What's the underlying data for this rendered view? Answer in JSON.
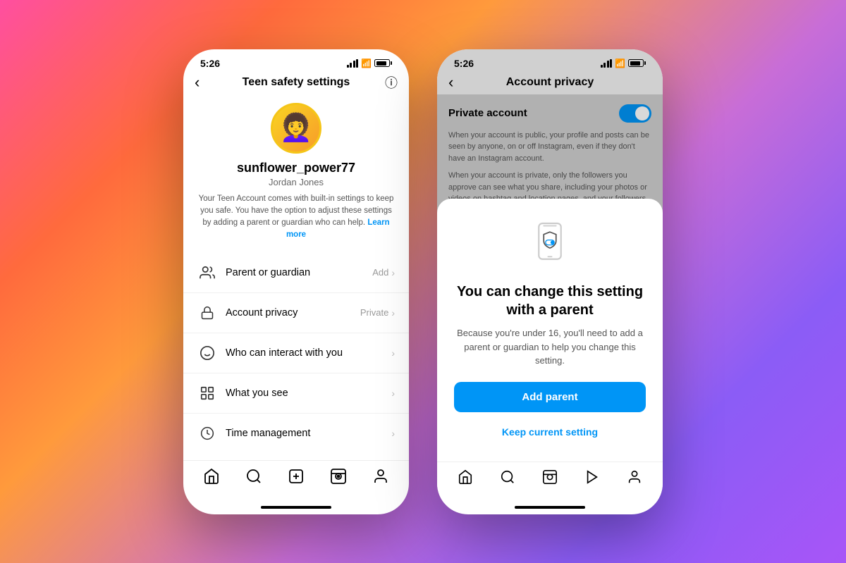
{
  "phone1": {
    "status": {
      "time": "5:26"
    },
    "header": {
      "back_label": "‹",
      "title": "Teen safety settings",
      "info_label": "ⓘ"
    },
    "profile": {
      "username": "sunflower_power77",
      "fullname": "Jordan Jones",
      "desc": "Your Teen Account comes with built-in settings to keep you safe. You have the option to adjust these settings by adding a parent or guardian who can help.",
      "learn_more": "Learn more"
    },
    "menu": [
      {
        "icon": "👤",
        "label": "Parent or guardian",
        "right_label": "Add",
        "has_chevron": true
      },
      {
        "icon": "🔒",
        "label": "Account privacy",
        "right_label": "Private",
        "has_chevron": true
      },
      {
        "icon": "😊",
        "label": "Who can interact with you",
        "right_label": "",
        "has_chevron": true
      },
      {
        "icon": "🛡",
        "label": "What you see",
        "right_label": "",
        "has_chevron": true
      },
      {
        "icon": "⏱",
        "label": "Time management",
        "right_label": "",
        "has_chevron": true
      }
    ],
    "bottom_nav": [
      "🏠",
      "🔍",
      "➕",
      "📺",
      "👤"
    ]
  },
  "phone2": {
    "status": {
      "time": "5:26"
    },
    "header": {
      "back_label": "‹",
      "title": "Account privacy"
    },
    "privacy": {
      "label": "Private account",
      "desc1": "When your account is public, your profile and posts can be seen by anyone, on or off Instagram, even if they don't have an Instagram account.",
      "desc2": "When your account is private, only the followers you approve can see what you share, including your photos or videos on hashtag and location pages, and your followers and following lists."
    },
    "modal": {
      "title": "You can change this setting with a parent",
      "desc": "Because you're under 16, you'll need to add a parent or guardian to help you change this setting.",
      "primary_btn": "Add parent",
      "secondary_btn": "Keep current setting"
    },
    "bottom_nav": [
      "🏠",
      "🔍",
      "📺",
      "▶️",
      "👤"
    ]
  }
}
